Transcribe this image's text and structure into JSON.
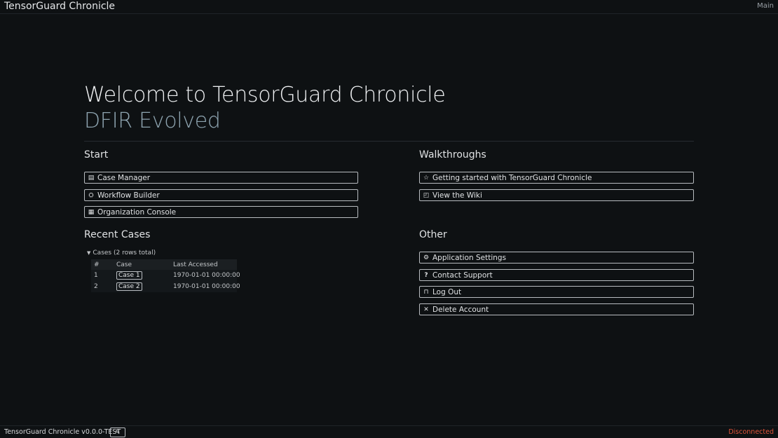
{
  "app": {
    "title": "TensorGuard Chronicle",
    "tab": "Main"
  },
  "hero": {
    "title": "Welcome to TensorGuard Chronicle",
    "subtitle": "DFIR Evolved"
  },
  "start": {
    "title": "Start",
    "buttons": [
      {
        "label": "Case Manager",
        "icon": "clipboard-icon"
      },
      {
        "label": "Workflow Builder",
        "icon": "workflow-icon"
      },
      {
        "label": "Organization Console",
        "icon": "building-icon"
      }
    ]
  },
  "walkthroughs": {
    "title": "Walkthroughs",
    "buttons": [
      {
        "label": "Getting started with TensorGuard Chronicle",
        "icon": "star-icon"
      },
      {
        "label": "View the Wiki",
        "icon": "book-icon"
      }
    ]
  },
  "recent": {
    "title": "Recent Cases",
    "header": "Cases (2 rows total)",
    "columns": [
      "#",
      "Case",
      "Last Accessed"
    ],
    "rows": [
      {
        "num": "1",
        "case": "Case 1",
        "accessed": "1970-01-01 00:00:00"
      },
      {
        "num": "2",
        "case": "Case 2",
        "accessed": "1970-01-01 00:00:00"
      }
    ]
  },
  "other": {
    "title": "Other",
    "buttons": [
      {
        "label": "Application Settings",
        "icon": "settings-icon"
      },
      {
        "label": "Contact Support",
        "icon": "question-icon"
      },
      {
        "label": "Log Out",
        "icon": "lock-icon"
      },
      {
        "label": "Delete Account",
        "icon": "close-icon"
      }
    ]
  },
  "footer": {
    "version": "TensorGuard Chronicle v0.0.0-TEST",
    "status": "Disconnected"
  },
  "colors": {
    "background": "#0e1113",
    "subtitle": "#8ea4b0",
    "status_error": "#e0533a"
  }
}
